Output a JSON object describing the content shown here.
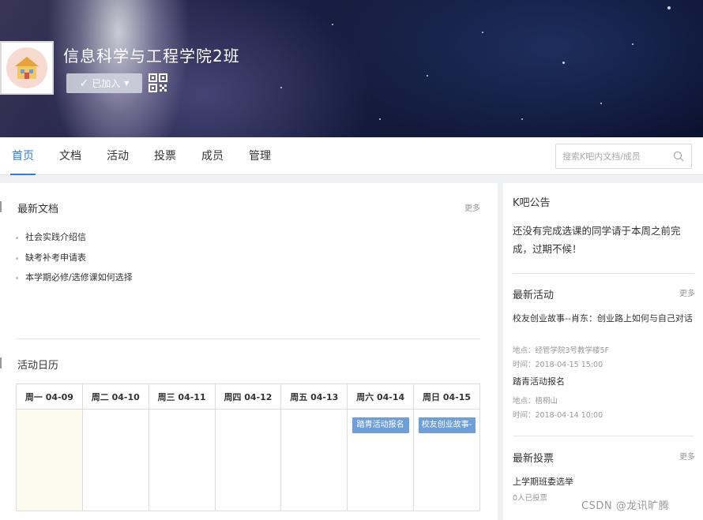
{
  "header": {
    "group_name": "信息科学与工程学院2班",
    "joined_label": "已加入",
    "icons": {
      "joined": "check-icon",
      "dropdown": "caret-down-icon",
      "qrcode": "qr-code-icon",
      "logo": "house-icon"
    }
  },
  "nav": {
    "tabs": [
      {
        "label": "首页",
        "active": true
      },
      {
        "label": "文档",
        "active": false
      },
      {
        "label": "活动",
        "active": false
      },
      {
        "label": "投票",
        "active": false
      },
      {
        "label": "成员",
        "active": false
      },
      {
        "label": "管理",
        "active": false
      }
    ],
    "search_placeholder": "搜索K吧内文档/成员",
    "accent_color": "#2f7de1"
  },
  "docs": {
    "title": "最新文档",
    "more": "更多",
    "items": [
      "社会实践介绍信",
      "缺考补考申请表",
      "本学期必修/选修课如何选择"
    ]
  },
  "calendar": {
    "title": "活动日历",
    "days": [
      "周一 04-09",
      "周二 04-10",
      "周三 04-11",
      "周四 04-12",
      "周五 04-13",
      "周六 04-14",
      "周日 04-15"
    ],
    "events": {
      "sat": "踏青活动报名",
      "sun": "校友创业故事-"
    }
  },
  "sidebar": {
    "notice_title": "K吧公告",
    "notice_text": "还没有完成选课的同学请于本周之前完成，过期不候！",
    "activities_title": "最新活动",
    "activities_more": "更多",
    "activities": [
      {
        "title": "校友创业故事--肖东：创业路上如何与自己对话",
        "location": "地点：经管学院3号教学楼5F",
        "time": "时间：2018-04-15 15:00"
      },
      {
        "title": "踏青活动报名",
        "location": "地点：梧桐山",
        "time": "时间：2018-04-14 10:00"
      }
    ],
    "votes_title": "最新投票",
    "votes_more": "更多",
    "votes": [
      {
        "title": "上学期班委选举",
        "count": "0人已投票"
      }
    ]
  },
  "watermark": "CSDN @龙讯旷腾",
  "colors": {
    "event_chip": "#6f9fd8",
    "today_cell": "#fdfbee"
  }
}
